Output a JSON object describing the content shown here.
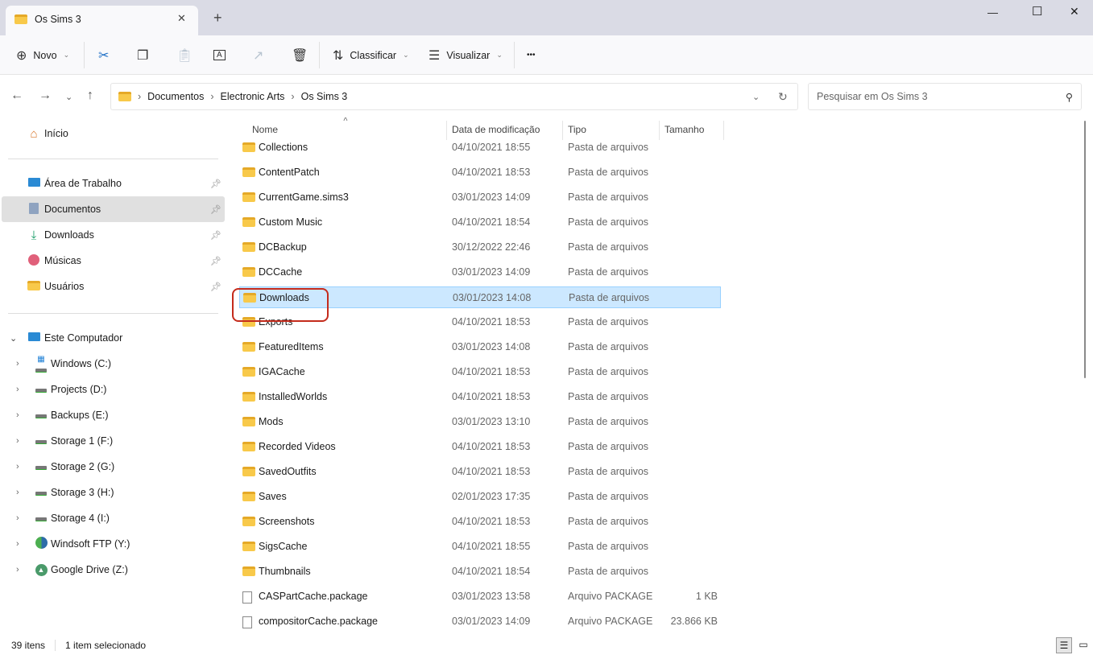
{
  "window": {
    "tab_title": "Os Sims 3",
    "new_tab": "+",
    "close_tab": "✕",
    "minimize": "—",
    "maximize": "☐",
    "close": "✕"
  },
  "toolbar": {
    "new_label": "Novo",
    "sort_label": "Classificar",
    "view_label": "Visualizar",
    "more": "•••"
  },
  "address": {
    "crumbs": [
      "Documentos",
      "Electronic Arts",
      "Os Sims 3"
    ],
    "search_placeholder": "Pesquisar em Os Sims 3"
  },
  "sidebar": {
    "home": "Início",
    "quick": [
      {
        "label": "Área de Trabalho",
        "icon": "desktop-icon"
      },
      {
        "label": "Documentos",
        "icon": "documents-icon",
        "selected": true
      },
      {
        "label": "Downloads",
        "icon": "download-icon"
      },
      {
        "label": "Músicas",
        "icon": "music-icon"
      },
      {
        "label": "Usuários",
        "icon": "folder-icon"
      }
    ],
    "computer": "Este Computador",
    "drives": [
      {
        "label": "Windows (C:)",
        "icon": "windows-drive-icon"
      },
      {
        "label": "Projects (D:)",
        "icon": "drive-icon"
      },
      {
        "label": "Backups (E:)",
        "icon": "drive-icon"
      },
      {
        "label": "Storage 1 (F:)",
        "icon": "drive-icon"
      },
      {
        "label": "Storage 2 (G:)",
        "icon": "drive-icon"
      },
      {
        "label": "Storage 3 (H:)",
        "icon": "drive-icon"
      },
      {
        "label": "Storage 4 (I:)",
        "icon": "drive-icon"
      },
      {
        "label": "Windsoft FTP (Y:)",
        "icon": "ftp-drive-icon"
      },
      {
        "label": "Google Drive (Z:)",
        "icon": "google-drive-icon"
      }
    ]
  },
  "columns": {
    "name": "Nome",
    "date": "Data de modificação",
    "type": "Tipo",
    "size": "Tamanho"
  },
  "files": [
    {
      "name": "Collections",
      "date": "04/10/2021 18:55",
      "type": "Pasta de arquivos",
      "size": ""
    },
    {
      "name": "ContentPatch",
      "date": "04/10/2021 18:53",
      "type": "Pasta de arquivos",
      "size": ""
    },
    {
      "name": "CurrentGame.sims3",
      "date": "03/01/2023 14:09",
      "type": "Pasta de arquivos",
      "size": ""
    },
    {
      "name": "Custom Music",
      "date": "04/10/2021 18:54",
      "type": "Pasta de arquivos",
      "size": ""
    },
    {
      "name": "DCBackup",
      "date": "30/12/2022 22:46",
      "type": "Pasta de arquivos",
      "size": ""
    },
    {
      "name": "DCCache",
      "date": "03/01/2023 14:09",
      "type": "Pasta de arquivos",
      "size": ""
    },
    {
      "name": "Downloads",
      "date": "03/01/2023 14:08",
      "type": "Pasta de arquivos",
      "size": "",
      "selected": true
    },
    {
      "name": "Exports",
      "date": "04/10/2021 18:53",
      "type": "Pasta de arquivos",
      "size": ""
    },
    {
      "name": "FeaturedItems",
      "date": "03/01/2023 14:08",
      "type": "Pasta de arquivos",
      "size": ""
    },
    {
      "name": "IGACache",
      "date": "04/10/2021 18:53",
      "type": "Pasta de arquivos",
      "size": ""
    },
    {
      "name": "InstalledWorlds",
      "date": "04/10/2021 18:53",
      "type": "Pasta de arquivos",
      "size": ""
    },
    {
      "name": "Mods",
      "date": "03/01/2023 13:10",
      "type": "Pasta de arquivos",
      "size": ""
    },
    {
      "name": "Recorded Videos",
      "date": "04/10/2021 18:53",
      "type": "Pasta de arquivos",
      "size": ""
    },
    {
      "name": "SavedOutfits",
      "date": "04/10/2021 18:53",
      "type": "Pasta de arquivos",
      "size": ""
    },
    {
      "name": "Saves",
      "date": "02/01/2023 17:35",
      "type": "Pasta de arquivos",
      "size": ""
    },
    {
      "name": "Screenshots",
      "date": "04/10/2021 18:53",
      "type": "Pasta de arquivos",
      "size": ""
    },
    {
      "name": "SigsCache",
      "date": "04/10/2021 18:55",
      "type": "Pasta de arquivos",
      "size": ""
    },
    {
      "name": "Thumbnails",
      "date": "04/10/2021 18:54",
      "type": "Pasta de arquivos",
      "size": ""
    },
    {
      "name": "CASPartCache.package",
      "date": "03/01/2023 13:58",
      "type": "Arquivo PACKAGE",
      "size": "1 KB",
      "file": true
    },
    {
      "name": "compositorCache.package",
      "date": "03/01/2023 14:09",
      "type": "Arquivo PACKAGE",
      "size": "23.866 KB",
      "file": true
    }
  ],
  "status": {
    "count": "39 itens",
    "selected": "1 item selecionado"
  },
  "colors": {
    "selection": "#cce8ff",
    "highlight": "#c42b1c",
    "folder": "#f8c94a"
  }
}
